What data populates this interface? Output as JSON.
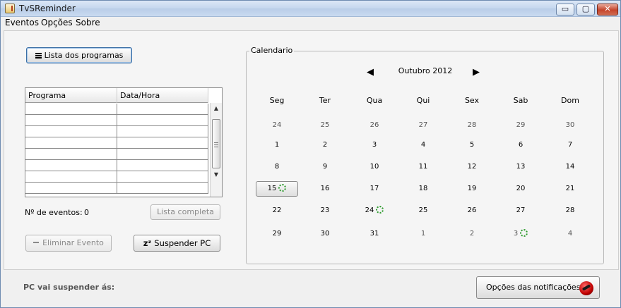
{
  "window": {
    "title": "TvSReminder",
    "controls": {
      "minimize": "▭",
      "maximize": "▢",
      "close": "✕"
    }
  },
  "menu": [
    "Eventos",
    "Opções",
    "Sobre"
  ],
  "left_panel": {
    "list_button": "Lista dos programas",
    "list_button_icon": "list-icon",
    "table": {
      "headers": [
        "Programa",
        "Data/Hora"
      ],
      "rows": [
        [
          "",
          ""
        ],
        [
          "",
          ""
        ],
        [
          "",
          ""
        ],
        [
          "",
          ""
        ],
        [
          "",
          ""
        ],
        [
          "",
          ""
        ],
        [
          "",
          ""
        ],
        [
          "",
          ""
        ]
      ]
    },
    "events_label": "Nº de eventos:",
    "events_count": "0",
    "full_list_button": "Lista completa",
    "remove_button": "Eliminar Evento",
    "remove_button_icon": "minus-icon",
    "suspend_button": "Suspender PC",
    "suspend_icon_text": "zᶻ"
  },
  "calendar": {
    "legend": "Calendario",
    "prev": "◀",
    "next": "▶",
    "month_label": "Outubro 2012",
    "weekdays": [
      "Seg",
      "Ter",
      "Qua",
      "Qui",
      "Sex",
      "Sab",
      "Dom"
    ],
    "weeks": [
      [
        {
          "d": "24",
          "other": true
        },
        {
          "d": "25",
          "other": true
        },
        {
          "d": "26",
          "other": true
        },
        {
          "d": "27",
          "other": true
        },
        {
          "d": "28",
          "other": true
        },
        {
          "d": "29",
          "other": true
        },
        {
          "d": "30",
          "other": true
        }
      ],
      [
        {
          "d": "1"
        },
        {
          "d": "2"
        },
        {
          "d": "3"
        },
        {
          "d": "4"
        },
        {
          "d": "5"
        },
        {
          "d": "6"
        },
        {
          "d": "7"
        }
      ],
      [
        {
          "d": "8"
        },
        {
          "d": "9"
        },
        {
          "d": "10"
        },
        {
          "d": "11"
        },
        {
          "d": "12"
        },
        {
          "d": "13"
        },
        {
          "d": "14"
        }
      ],
      [
        {
          "d": "15",
          "selected": true,
          "event": true
        },
        {
          "d": "16"
        },
        {
          "d": "17"
        },
        {
          "d": "18"
        },
        {
          "d": "19"
        },
        {
          "d": "20"
        },
        {
          "d": "21"
        }
      ],
      [
        {
          "d": "22"
        },
        {
          "d": "23"
        },
        {
          "d": "24",
          "event": true
        },
        {
          "d": "25"
        },
        {
          "d": "26"
        },
        {
          "d": "27"
        },
        {
          "d": "28"
        }
      ],
      [
        {
          "d": "29"
        },
        {
          "d": "30"
        },
        {
          "d": "31"
        },
        {
          "d": "1",
          "other": true
        },
        {
          "d": "2",
          "other": true
        },
        {
          "d": "3",
          "other": true,
          "event": true
        },
        {
          "d": "4",
          "other": true
        }
      ]
    ]
  },
  "status": {
    "suspend_label": "PC vai suspender ás:",
    "notifications_button": "Opções das notificações",
    "notifications_icon": "alarm-icon"
  }
}
